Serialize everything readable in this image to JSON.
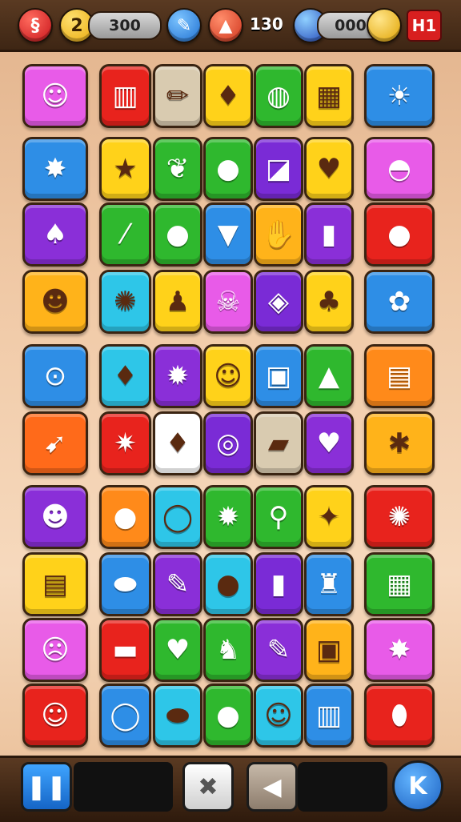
{
  "hud": {
    "left_badge_glyph": "§",
    "hearts_count": "2",
    "score_value": "300",
    "time_value": "130",
    "gems_value": "000",
    "level_label": "H1",
    "colors": {
      "red": "#d8262a",
      "blue": "#2b7fd6",
      "gold": "#f2c018"
    }
  },
  "board": {
    "tile_icons": [
      [
        "face-bush",
        "window",
        "pencil",
        "popsicle",
        "disco-ball",
        "juice-box",
        "sun"
      ],
      [
        "spiky-fruit",
        "star",
        "frog",
        "chick",
        "paper",
        "heart",
        "ufo-lips"
      ],
      [
        "red-bird",
        "crayon",
        "pumpkin",
        "fox-face",
        "thumbs-up",
        "bottle",
        "red-blob"
      ],
      [
        "fox-head",
        "spiky-ball",
        "pink-creature",
        "skull-face",
        "purple-leaf",
        "mushroom",
        "snail"
      ],
      [
        "lollipop",
        "strawberry-man",
        "sun-creature",
        "dog-face",
        "camera",
        "bottle-pop",
        "clipboard"
      ],
      [
        "rocket",
        "starburst",
        "chili",
        "donut",
        "eraser-pen",
        "pink-heart",
        "crab"
      ],
      [
        "cat-face",
        "green-apple",
        "purple-balloon",
        "red-monster",
        "location-pin",
        "leaf-star",
        "red-sun"
      ],
      [
        "book",
        "carrot",
        "crayon-2",
        "bomb",
        "orange-bottle",
        "vase",
        "film-strip"
      ],
      [
        "red-face",
        "eraser",
        "green-heart",
        "robot-rocket",
        "glue",
        "cash-register",
        "gold-star"
      ],
      [
        "lamb",
        "ring",
        "carrot-2",
        "tomato",
        "pea-creature",
        "green-bin",
        "bean"
      ]
    ]
  },
  "controls": {
    "pause_glyph": "❚❚",
    "shuffle_glyph": "✖",
    "back_glyph": "◀",
    "hint_glyph": "K"
  }
}
